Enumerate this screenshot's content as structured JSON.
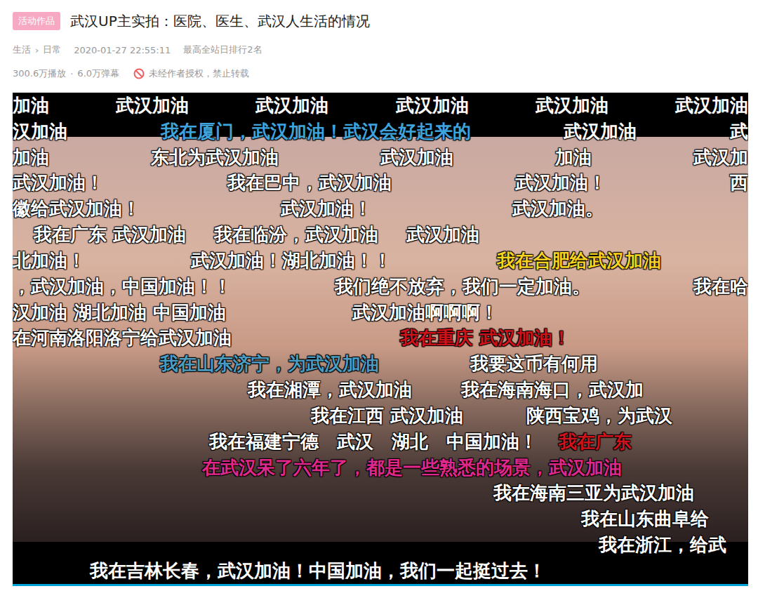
{
  "header": {
    "badge": "活动作品",
    "title": "武汉UP主实拍：医院、医生、武汉人生活的情况"
  },
  "meta": {
    "category": "生活",
    "separator": "›",
    "subcategory": "日常",
    "time": "2020-01-27 22:55:11",
    "rank": "最高全站日排行2名"
  },
  "stats": {
    "plays": "300.6万播放",
    "dot": "·",
    "danmaku_count": "6.0万弹幕",
    "notice": "未经作者授权，禁止转载"
  },
  "danmaku": {
    "lanes": [
      {
        "items": [
          {
            "text": "加油",
            "color": "#ffffff"
          },
          {
            "text": "武汉加油",
            "color": "#ffffff"
          },
          {
            "text": "武汉加油",
            "color": "#ffffff"
          },
          {
            "text": "武汉加油",
            "color": "#ffffff"
          },
          {
            "text": "武汉加油",
            "color": "#ffffff"
          },
          {
            "text": "武汉加油",
            "color": "#ffffff"
          }
        ]
      },
      {
        "items": [
          {
            "text": "汉加油",
            "color": "#ffffff"
          },
          {
            "text": "我在厦门，武汉加油！武汉会好起来的",
            "color": "#3fa3dc"
          },
          {
            "text": "武汉加油",
            "color": "#ffffff"
          },
          {
            "text": "武",
            "color": "#ffffff"
          }
        ]
      },
      {
        "items": [
          {
            "text": "加油",
            "color": "#ffffff"
          },
          {
            "text": "东北为武汉加油",
            "color": "#ffffff"
          },
          {
            "text": "武汉加油",
            "color": "#ffffff"
          },
          {
            "text": "加油",
            "color": "#ffffff"
          },
          {
            "text": "武汉加",
            "color": "#ffffff"
          }
        ]
      },
      {
        "items": [
          {
            "text": "武汉加油！",
            "color": "#ffffff"
          },
          {
            "text": "我在巴中，武汉加油",
            "color": "#ffffff"
          },
          {
            "text": "武汉加油！",
            "color": "#ffffff"
          },
          {
            "text": "西",
            "color": "#ffffff"
          }
        ]
      },
      {
        "items": [
          {
            "text": "徽给武汉加油！",
            "color": "#ffffff"
          },
          {
            "text": "武汉加油！",
            "color": "#ffffff"
          },
          {
            "text": "武汉加油。",
            "color": "#ffffff"
          }
        ]
      },
      {
        "items": [
          {
            "text": "我在广东 武汉加油",
            "color": "#ffffff"
          },
          {
            "text": "我在临汾，武汉加油",
            "color": "#ffffff"
          },
          {
            "text": "武汉加油",
            "color": "#ffffff"
          }
        ]
      },
      {
        "items": [
          {
            "text": "北加油！",
            "color": "#ffffff"
          },
          {
            "text": "武汉加油！湖北加油！！",
            "color": "#ffffff"
          },
          {
            "text": "我在合肥给武汉加油",
            "color": "#f7d21e"
          }
        ]
      },
      {
        "items": [
          {
            "text": "，武汉加油，中国加油！！",
            "color": "#ffffff"
          },
          {
            "text": "我们绝不放弃，我们一定加油。",
            "color": "#ffffff"
          },
          {
            "text": "我在哈",
            "color": "#ffffff"
          }
        ]
      },
      {
        "items": [
          {
            "text": "汉加油 湖北加油 中国加油",
            "color": "#ffffff"
          },
          {
            "text": "武汉加油啊啊啊！",
            "color": "#ffffff"
          }
        ]
      },
      {
        "items": [
          {
            "text": "在河南洛阳洛宁给武汉加油",
            "color": "#ffffff"
          },
          {
            "text": "我在重庆 武汉加油！",
            "color": "#d0121b"
          }
        ]
      },
      {
        "items": [
          {
            "text": "我在山东济宁，为武汉加油",
            "color": "#4a9cc0"
          },
          {
            "text": "我要这币有何用",
            "color": "#ffffff"
          }
        ]
      },
      {
        "items": [
          {
            "text": "我在湘潭，武汉加油",
            "color": "#ffffff"
          },
          {
            "text": "我在海南海口，武汉加",
            "color": "#ffffff"
          }
        ]
      },
      {
        "items": [
          {
            "text": "我在江西 武汉加油",
            "color": "#ffffff"
          },
          {
            "text": "陕西宝鸡，为武汉",
            "color": "#ffffff"
          }
        ]
      },
      {
        "items": [
          {
            "text": "我在福建宁德　武汉　湖北　中国加油！",
            "color": "#ffffff"
          },
          {
            "text": "我在广东",
            "color": "#d0121b"
          }
        ]
      },
      {
        "items": [
          {
            "text": "在武汉呆了六年了，都是一些熟悉的场景，武汉加油",
            "color": "#e0288c"
          }
        ]
      },
      {
        "items": [
          {
            "text": "我在海南三亚为武汉加油",
            "color": "#ffffff"
          }
        ]
      },
      {
        "items": [
          {
            "text": "我在山东曲阜给",
            "color": "#ffffff"
          }
        ]
      },
      {
        "items": [
          {
            "text": "我在浙江，给武",
            "color": "#ffffff"
          }
        ]
      },
      {
        "items": [
          {
            "text": "我在吉林长春，武汉加油！中国加油，我们一起挺过去！",
            "color": "#ffffff"
          }
        ]
      }
    ]
  }
}
